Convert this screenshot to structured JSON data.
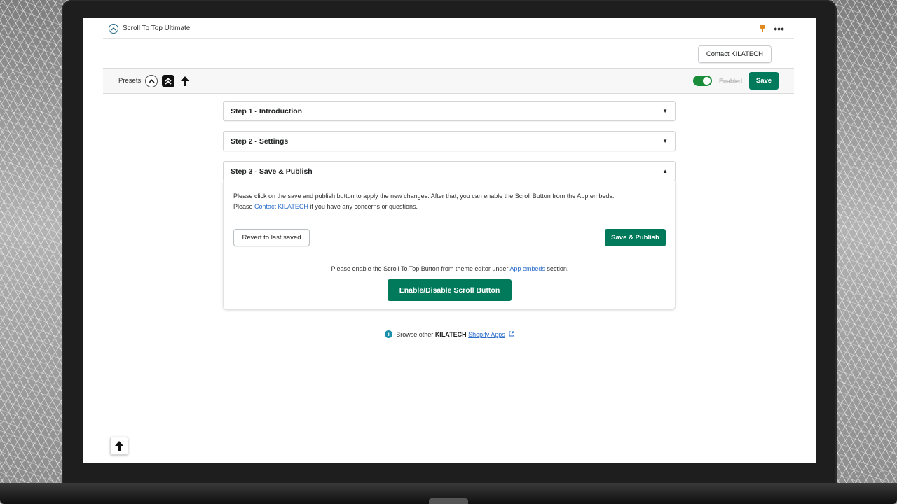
{
  "app": {
    "title": "Scroll To Top Ultimate",
    "logo_glyph": "^",
    "menu_glyph": "•••"
  },
  "header": {
    "contact_button": "Contact KILATECH"
  },
  "toolbar": {
    "presets_label": "Presets",
    "preset_icons": [
      "circle-chevron-up-icon",
      "square-double-chevron-up-icon",
      "arrow-up-icon"
    ],
    "enabled_label": "Enabled",
    "enabled": true,
    "save_label": "Save"
  },
  "steps": [
    {
      "label": "Step 1 - Introduction",
      "expanded": false
    },
    {
      "label": "Step 2 - Settings",
      "expanded": false
    },
    {
      "label": "Step 3 - Save & Publish",
      "expanded": true
    }
  ],
  "step3": {
    "line1": "Please click on the save and publish button to apply the new changes. After that, you can enable the Scroll Button from the App embeds.",
    "line2_prefix": "Please ",
    "line2_link": "Contact KILATECH",
    "line2_suffix": " if you have any concerns or questions.",
    "revert_label": "Revert to last saved",
    "publish_label": "Save & Publish",
    "embed_prefix": "Please enable the Scroll To Top Button from theme editor under ",
    "embed_link": "App embeds",
    "embed_suffix": " section.",
    "toggle_button_label": "Enable/Disable Scroll Button"
  },
  "footer": {
    "prefix": "Browse other ",
    "brand": "KILATECH",
    "link": "Shopify Apps"
  },
  "colors": {
    "primary": "#007a5a",
    "toggle_on": "#1a8d3a",
    "link": "#2c6ecb",
    "pin": "#e08a1e"
  }
}
